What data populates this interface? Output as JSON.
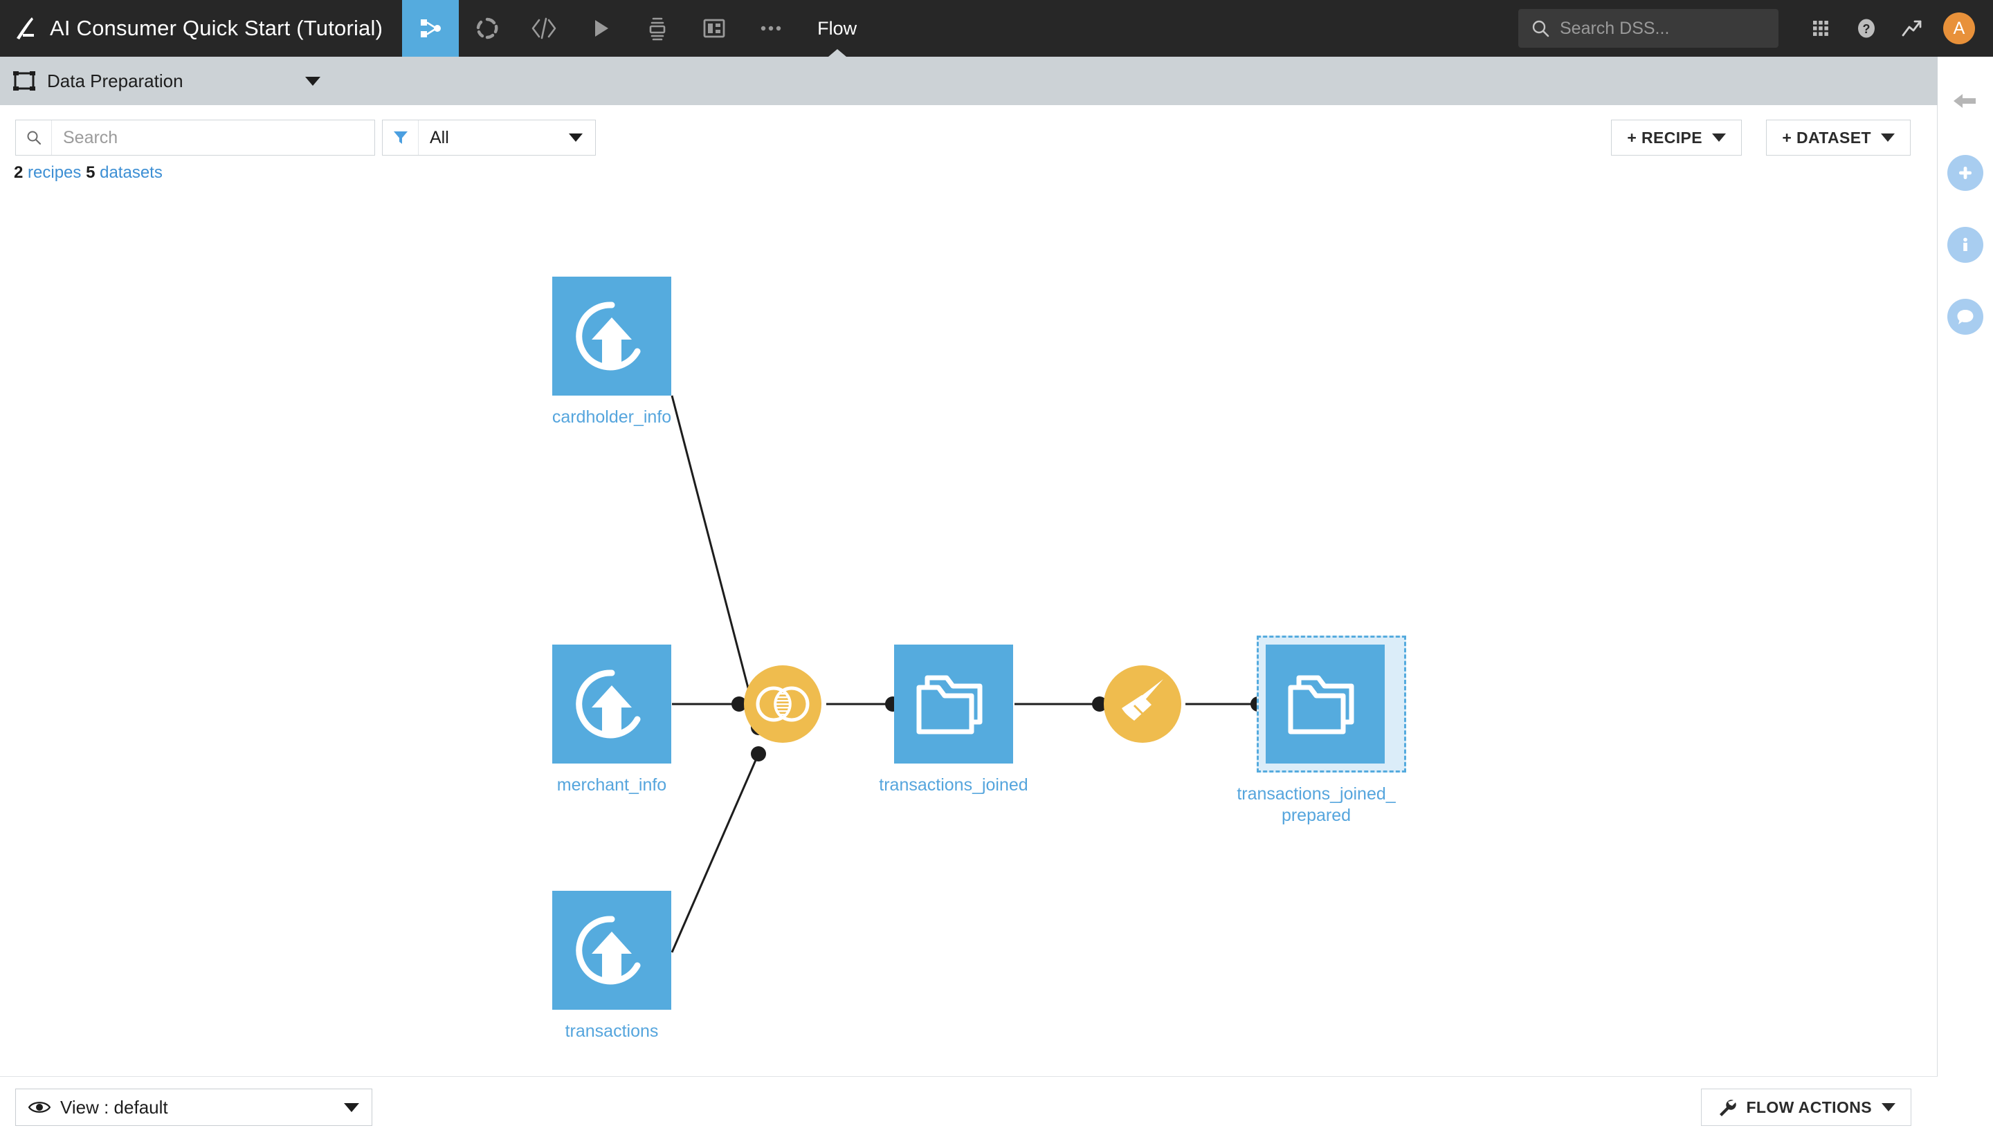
{
  "topnav": {
    "logo_icon": "dataiku-bird-logo",
    "project_title": "AI Consumer Quick Start (Tutorial)",
    "icons": [
      {
        "name": "flow-icon",
        "label": "Flow",
        "active": true
      },
      {
        "name": "lab-icon",
        "label": "Lab",
        "active": false
      },
      {
        "name": "code-icon",
        "label": "Code",
        "active": false
      },
      {
        "name": "jobs-play-icon",
        "label": "Jobs",
        "active": false
      },
      {
        "name": "automation-icon",
        "label": "Automation",
        "active": false
      },
      {
        "name": "dashboard-icon",
        "label": "Dashboards",
        "active": false
      },
      {
        "name": "more-ellipsis-icon",
        "label": "More",
        "active": false
      }
    ],
    "current_section": "Flow",
    "search": {
      "placeholder": "Search DSS...",
      "value": "",
      "icon": "search-icon"
    },
    "right_icons": [
      {
        "name": "apps-grid-icon"
      },
      {
        "name": "help-question-icon"
      },
      {
        "name": "trending-up-icon"
      }
    ],
    "avatar": {
      "initial": "A",
      "color": "#e8913a"
    }
  },
  "zonebar": {
    "zone_icon": "flow-zone-icon",
    "zone_name": "Data Preparation",
    "caret_icon": "chevron-down-icon",
    "close_icon": "close-icon"
  },
  "toolbar": {
    "search": {
      "placeholder": "Search",
      "value": "",
      "icon": "search-icon"
    },
    "filter": {
      "icon": "filter-funnel-icon",
      "value": "All",
      "options": [
        "All"
      ]
    },
    "counts": {
      "recipes_number": "2",
      "recipes_label": "recipes",
      "datasets_number": "5",
      "datasets_label": "datasets"
    },
    "recipe_button": {
      "label": "+ RECIPE",
      "caret": "chevron-down-icon"
    },
    "dataset_button": {
      "label": "+ DATASET",
      "caret": "chevron-down-icon"
    }
  },
  "flow": {
    "nodes": [
      {
        "id": "cardholder_info",
        "label": "cardholder_info",
        "type": "dataset",
        "icon": "upload-dataset-icon",
        "selected": false
      },
      {
        "id": "merchant_info",
        "label": "merchant_info",
        "type": "dataset",
        "icon": "upload-dataset-icon",
        "selected": false
      },
      {
        "id": "transactions",
        "label": "transactions",
        "type": "dataset",
        "icon": "upload-dataset-icon",
        "selected": false
      },
      {
        "id": "join_recipe",
        "label": "",
        "type": "recipe",
        "icon": "join-venn-icon",
        "selected": false
      },
      {
        "id": "transactions_joined",
        "label": "transactions_joined",
        "type": "dataset",
        "icon": "managed-folder-icon",
        "selected": false
      },
      {
        "id": "prepare_recipe",
        "label": "",
        "type": "recipe",
        "icon": "prepare-broom-icon",
        "selected": false
      },
      {
        "id": "transactions_joined_prepared",
        "label": "transactions_joined_\nprepared",
        "type": "dataset",
        "icon": "managed-folder-icon",
        "selected": true
      }
    ],
    "node_labels": {
      "cardholder_info": "cardholder_info",
      "merchant_info": "merchant_info",
      "transactions": "transactions",
      "transactions_joined": "transactions_joined",
      "transactions_joined_prepared_line1": "transactions_joined_",
      "transactions_joined_prepared_line2": "prepared"
    },
    "edges": [
      {
        "from": "cardholder_info",
        "to": "join_recipe"
      },
      {
        "from": "merchant_info",
        "to": "join_recipe"
      },
      {
        "from": "transactions",
        "to": "join_recipe"
      },
      {
        "from": "join_recipe",
        "to": "transactions_joined"
      },
      {
        "from": "transactions_joined",
        "to": "prepare_recipe"
      },
      {
        "from": "prepare_recipe",
        "to": "transactions_joined_prepared"
      }
    ],
    "colors": {
      "dataset": "#55abde",
      "recipe": "#efbc4e",
      "label": "#55a5dd",
      "edge": "#1d1d1d",
      "selection": "#55abde"
    }
  },
  "bottombar": {
    "view_select": {
      "icon": "eye-icon",
      "label": "View : default",
      "caret": "chevron-down-icon"
    },
    "flow_actions": {
      "icon": "wrench-icon",
      "label": "FLOW ACTIONS",
      "caret": "chevron-down-icon"
    }
  },
  "rail": {
    "items": [
      {
        "name": "collapse-left-arrow-icon",
        "style": "plain"
      },
      {
        "name": "add-plus-icon",
        "style": "round"
      },
      {
        "name": "info-icon",
        "style": "round"
      },
      {
        "name": "chat-bubble-icon",
        "style": "round"
      }
    ]
  }
}
